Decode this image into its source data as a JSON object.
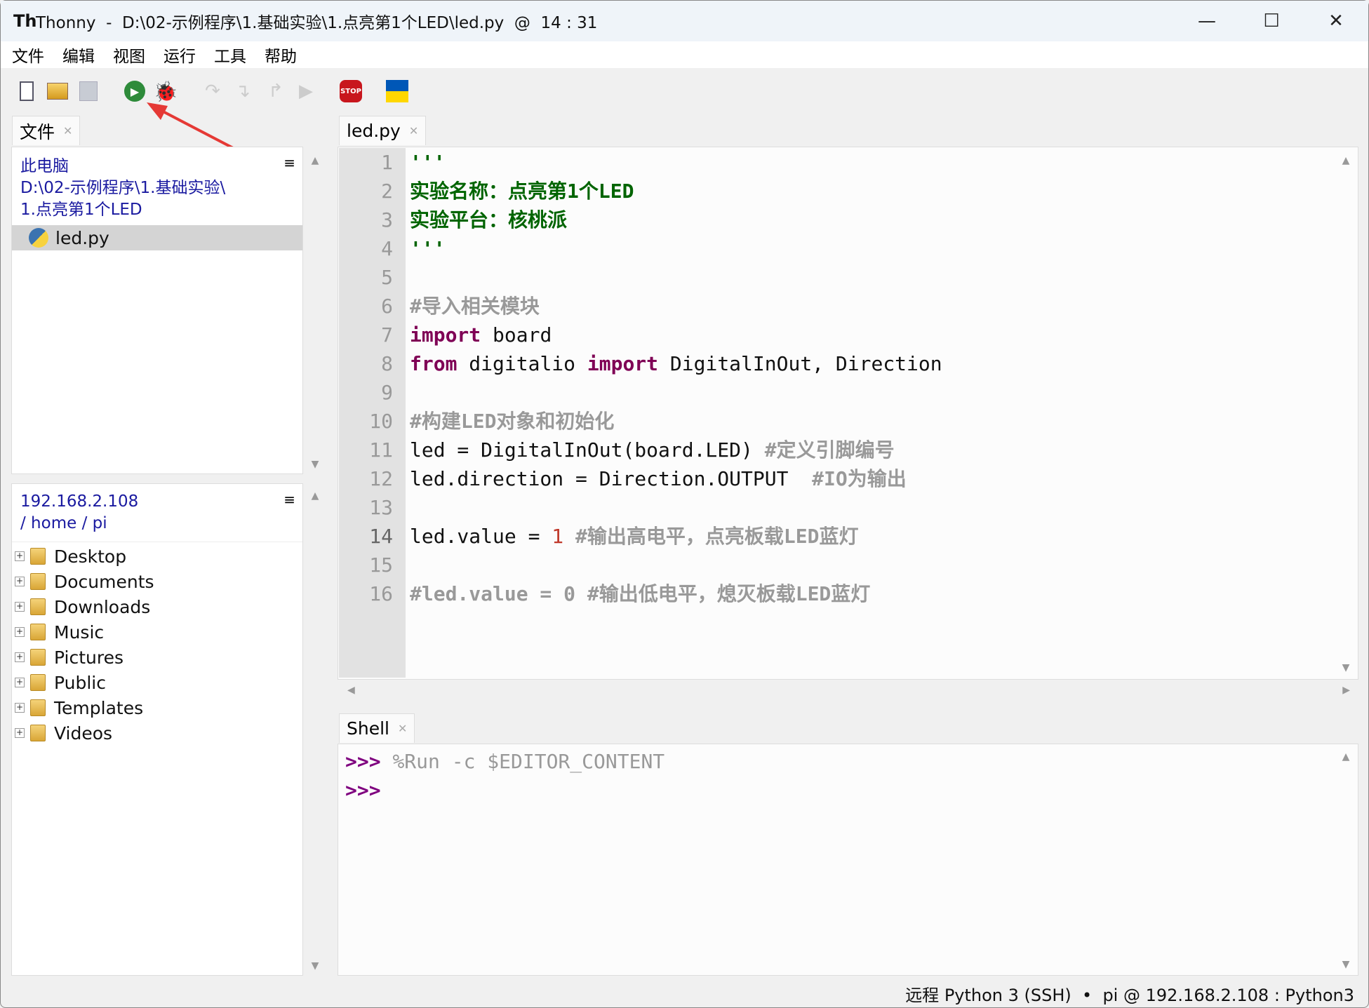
{
  "window": {
    "title": "Thonny  -  D:\\02-示例程序\\1.基础实验\\1.点亮第1个LED\\led.py  @  14 : 31",
    "logo": "Th"
  },
  "menu": [
    "文件",
    "编辑",
    "视图",
    "运行",
    "工具",
    "帮助"
  ],
  "toolbar": {
    "icons": [
      "new-file-icon",
      "open-file-icon",
      "save-icon",
      "run-icon",
      "debug-icon",
      "step-over-icon",
      "step-into-icon",
      "step-out-icon",
      "resume-icon",
      "stop-icon",
      "ukraine-flag-icon"
    ],
    "stop_label": "STOP"
  },
  "files": {
    "tab": "文件",
    "local": {
      "path": [
        "此电脑",
        "D:\\02-示例程序\\1.基础实验\\",
        "1.点亮第1个LED"
      ],
      "items": [
        "led.py"
      ]
    },
    "remote": {
      "host": "192.168.2.108",
      "path": "/ home / pi",
      "items": [
        "Desktop",
        "Documents",
        "Downloads",
        "Music",
        "Pictures",
        "Public",
        "Templates",
        "Videos"
      ]
    }
  },
  "editor": {
    "tab": "led.py",
    "current_line": 14,
    "lines": [
      [
        [
          "s",
          "'''"
        ]
      ],
      [
        [
          "s",
          "实验名称：点亮第1个LED"
        ]
      ],
      [
        [
          "s",
          "实验平台：核桃派"
        ]
      ],
      [
        [
          "s",
          "'''"
        ]
      ],
      [],
      [
        [
          "c",
          "#导入相关模块"
        ]
      ],
      [
        [
          "k",
          "import"
        ],
        [
          "p",
          " board"
        ]
      ],
      [
        [
          "k",
          "from"
        ],
        [
          "p",
          " digitalio "
        ],
        [
          "k",
          "import"
        ],
        [
          "p",
          " DigitalInOut, Direction"
        ]
      ],
      [],
      [
        [
          "c",
          "#构建LED对象和初始化"
        ]
      ],
      [
        [
          "p",
          "led = DigitalInOut(board.LED) "
        ],
        [
          "c",
          "#定义引脚编号"
        ]
      ],
      [
        [
          "p",
          "led.direction = Direction.OUTPUT  "
        ],
        [
          "c",
          "#IO为输出"
        ]
      ],
      [],
      [
        [
          "p",
          "led.value = "
        ],
        [
          "n",
          "1"
        ],
        [
          "p",
          " "
        ],
        [
          "c",
          "#输出高电平，点亮板载LED蓝灯"
        ]
      ],
      [],
      [
        [
          "c",
          "#led.value = 0 #输出低电平，熄灭板载LED蓝灯"
        ]
      ]
    ]
  },
  "shell": {
    "tab": "Shell",
    "prompt": ">>>",
    "lines": [
      "%Run -c $EDITOR_CONTENT",
      ""
    ]
  },
  "status": "远程 Python 3 (SSH)  •  pi @ 192.168.2.108 : Python3",
  "colors": {
    "keyword": "#7f0055",
    "string": "#006400",
    "comment": "#999999",
    "number": "#c0392b",
    "annotation_arrow": "#e53935"
  }
}
